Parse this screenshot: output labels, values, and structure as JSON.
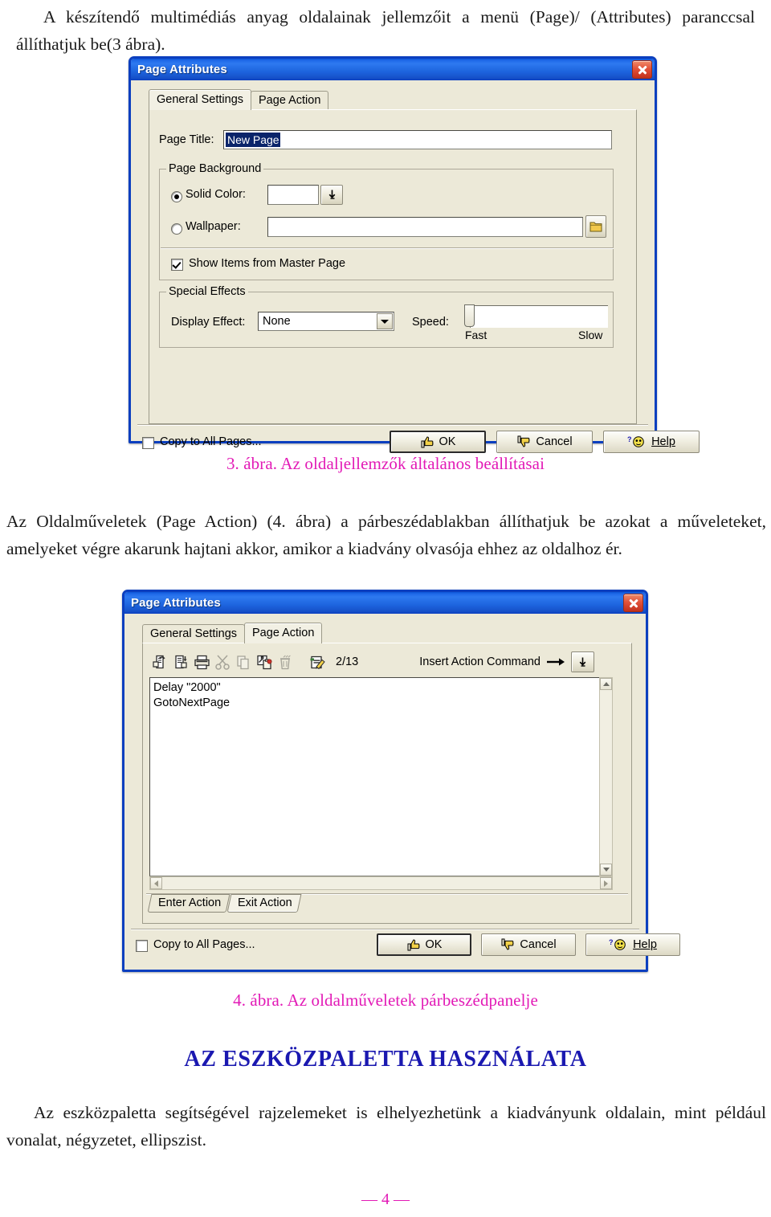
{
  "document": {
    "paragraph_1": "A készítendő multimédiás anyag oldalainak jellemzőit a menü (Page)/ (Attributes) paranccsal állíthatjuk be(3 ábra).",
    "figure_3_caption": "3. ábra. Az oldaljellemzők általános beállításai",
    "paragraph_2": "Az Oldalműveletek (Page Action) (4. ábra) a párbeszédablakban állíthatjuk be azokat a műveleteket, amelyeket végre akarunk hajtani akkor, amikor a kiadvány olvasója ehhez az oldalhoz ér.",
    "figure_4_caption": "4. ábra. Az oldalműveletek párbeszédpanelje",
    "section_heading": "AZ ESZKÖZPALETTA HASZNÁLATA",
    "paragraph_3": "Az eszközpaletta segítségével rajzelemeket is elhelyezhetünk a kiadványunk oldalain, mint például vonalat, négyzetet, ellipszist.",
    "page_number": "— 4 —"
  },
  "colors": {
    "caption_pink": "#e21ab6",
    "heading_blue": "#1a18b0",
    "dialog_face": "#ece9d8",
    "title_blue": "#0b3fbf",
    "selection_blue": "#0a246a"
  },
  "dialog_general": {
    "title": "Page Attributes",
    "close_icon": "close-icon",
    "tabs": [
      {
        "label": "General Settings",
        "active": true
      },
      {
        "label": "Page Action",
        "active": false
      }
    ],
    "page_title": {
      "label": "Page Title:",
      "value": "New Page"
    },
    "page_background": {
      "legend": "Page Background",
      "solid_color": {
        "label": "Solid Color:",
        "selected": true,
        "value": "",
        "dropdown_icon": "color-dropdown-icon"
      },
      "wallpaper": {
        "label": "Wallpaper:",
        "selected": false,
        "value": "",
        "placeholder": "",
        "browse_icon": "folder-icon"
      },
      "show_master": {
        "label": "Show Items from Master Page",
        "checked": true
      }
    },
    "special_effects": {
      "legend": "Special Effects",
      "display_effect": {
        "label": "Display Effect:",
        "value": "None",
        "options": [
          "None"
        ]
      },
      "speed": {
        "label": "Speed:",
        "min_label": "Fast",
        "max_label": "Slow",
        "value": 0
      }
    },
    "footer": {
      "copy_all_pages": {
        "label": "Copy to All Pages...",
        "checked": false
      },
      "ok": "OK",
      "cancel": "Cancel",
      "help": "Help"
    }
  },
  "dialog_action": {
    "title": "Page Attributes",
    "close_icon": "close-icon",
    "tabs": [
      {
        "label": "General Settings",
        "active": false
      },
      {
        "label": "Page Action",
        "active": true
      }
    ],
    "toolbar": {
      "icons": [
        {
          "name": "open-file-icon",
          "disabled": false
        },
        {
          "name": "save-file-icon",
          "disabled": false
        },
        {
          "name": "print-icon",
          "disabled": false
        },
        {
          "name": "cut-icon",
          "disabled": true
        },
        {
          "name": "copy-icon",
          "disabled": true
        },
        {
          "name": "paste-icon",
          "disabled": false
        },
        {
          "name": "delete-icon",
          "disabled": true
        },
        {
          "name": "edit-action-icon",
          "disabled": false
        }
      ],
      "counter": "2/13",
      "insert_label": "Insert Action Command",
      "insert_arrow_icon": "arrow-right-icon",
      "insert_dropdown_icon": "dropdown-arrow-icon"
    },
    "action_list": [
      "Delay \"2000\"",
      "GotoNextPage"
    ],
    "sub_tabs": [
      {
        "label": "Enter Action",
        "active": false
      },
      {
        "label": "Exit Action",
        "active": true
      }
    ],
    "footer": {
      "copy_all_pages": {
        "label": "Copy to All Pages...",
        "checked": false
      },
      "ok": "OK",
      "cancel": "Cancel",
      "help": "Help"
    }
  }
}
